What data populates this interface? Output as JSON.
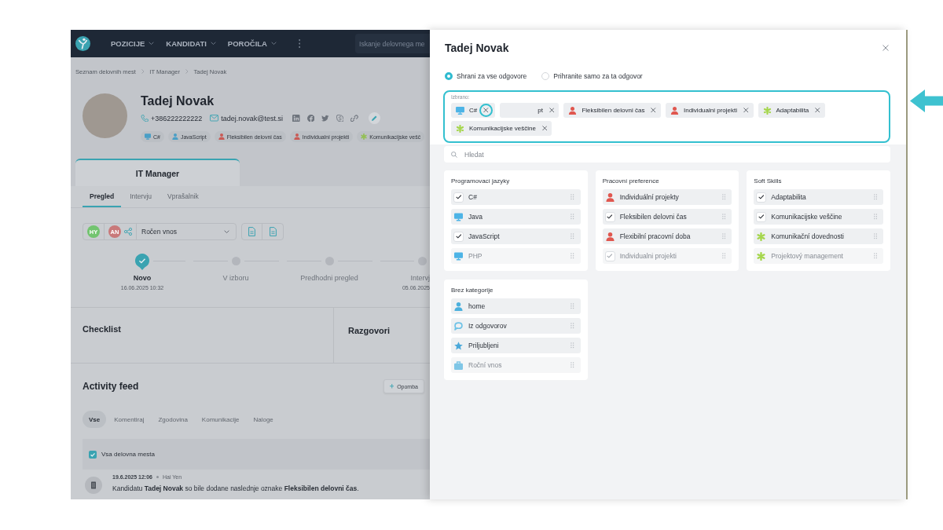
{
  "navbar": {
    "menu": [
      {
        "label": "POZICIJE"
      },
      {
        "label": "KANDIDATI"
      },
      {
        "label": "POROČILA"
      }
    ],
    "search": {
      "placeholder": "Iskanje delovnega me"
    }
  },
  "breadcrumb": [
    {
      "label": "Seznam delovnih mest"
    },
    {
      "label": "IT Manager"
    },
    {
      "label": "Tadej Novak"
    }
  ],
  "candidate": {
    "name": "Tadej Novak",
    "phone": "+386222222222",
    "email": "tadej.novak@test.si",
    "tags": [
      {
        "label": "C#",
        "kind": "monitor",
        "color": "#4a9fc6"
      },
      {
        "label": "JavaScript",
        "kind": "person",
        "color": "#4a9fc6"
      },
      {
        "label": "Fleksibilen delovni čas",
        "kind": "person",
        "color": "#c95a55"
      },
      {
        "label": "Individualni projekti",
        "kind": "person",
        "color": "#c95a55"
      },
      {
        "label": "Komunikacijske vešč",
        "kind": "asterisk",
        "color": "#93bf55"
      }
    ]
  },
  "position_tab": {
    "title": "IT Manager"
  },
  "subtabs": [
    {
      "label": "Pregled",
      "selected": true
    },
    {
      "label": "Intervju",
      "selected": false
    },
    {
      "label": "Vprašalnik",
      "selected": false
    }
  ],
  "toolbar": {
    "avatars": [
      {
        "initials": "HY",
        "color": "#72c46f"
      },
      {
        "initials": "AN",
        "color": "#c9797a"
      }
    ],
    "source": "Ročen vnos"
  },
  "pipeline": [
    {
      "label": "Novo",
      "date": "16.06.2025 10:32",
      "done": true
    },
    {
      "label": "V izboru",
      "done": false
    },
    {
      "label": "Predhodni pregled",
      "done": false
    },
    {
      "label": "Intervj",
      "date": "05.06.2025",
      "done": false
    }
  ],
  "sections": [
    {
      "title": "Checklist"
    },
    {
      "title": "Razgovori"
    }
  ],
  "activity": {
    "title": "Activity feed",
    "add_button": "Opomba",
    "filters": [
      {
        "label": "Vse",
        "selected": true
      },
      {
        "label": "Komentiraj",
        "selected": false
      },
      {
        "label": "Zgodovina",
        "selected": false
      },
      {
        "label": "Komunikacije",
        "selected": false
      },
      {
        "label": "Naloge",
        "selected": false
      }
    ],
    "all_positions": {
      "label": "Vsa delovna mesta",
      "checked": true
    },
    "entries": [
      {
        "time": "19.6.2025 12:06",
        "author": "Hai Yen",
        "text": "Kandidatu **Tadej Novak** so bile dodane naslednje oznake **Fleksibilen delovni čas**."
      }
    ]
  },
  "drawer": {
    "title": "Tadej Novak",
    "scope": [
      {
        "label": "Shrani za vse odgovore",
        "selected": true
      },
      {
        "label": "Prihranite samo za ta odgovor",
        "selected": false
      }
    ],
    "selected_tags": {
      "label": "Izbrano:",
      "tags": [
        {
          "label": "C#",
          "kind": "monitor",
          "color": "#4db4e6",
          "highlighted": true
        },
        {
          "label": "pt",
          "highlighted": false
        },
        {
          "label": "Fleksibilen delovni čas",
          "kind": "person",
          "color": "#e0574f",
          "highlighted": false
        },
        {
          "label": "Individualni projekti",
          "kind": "person",
          "color": "#e0574f",
          "highlighted": false
        },
        {
          "label": "Adaptabilita",
          "kind": "asterisk",
          "color": "#a5d64c",
          "highlighted": false
        },
        {
          "label": "Komunikacijske veščine",
          "kind": "asterisk",
          "color": "#a5d64c",
          "highlighted": false
        }
      ]
    },
    "search": {
      "placeholder": "Hledat"
    },
    "categories": [
      {
        "title": "Programovací jazyky",
        "items": [
          {
            "label": "C#",
            "checked": true
          },
          {
            "label": "Java",
            "checked": false,
            "kind": "monitor",
            "color": "#4db4e6"
          },
          {
            "label": "JavaScript",
            "checked": true
          },
          {
            "label": "PHP",
            "checked": false,
            "kind": "monitor",
            "color": "#4db4e6"
          }
        ]
      },
      {
        "title": "Pracovní preference",
        "items": [
          {
            "label": "Individuální projekty",
            "checked": false,
            "kind": "person",
            "color": "#e0574f"
          },
          {
            "label": "Fleksibilen delovni čas",
            "checked": true
          },
          {
            "label": "Flexibilní pracovní doba",
            "checked": false,
            "kind": "person",
            "color": "#e0574f"
          },
          {
            "label": "Individualni projekti",
            "checked": true
          }
        ]
      },
      {
        "title": "Soft Skills",
        "items": [
          {
            "label": "Adaptabilita",
            "checked": true
          },
          {
            "label": "Komunikacijske veščine",
            "checked": true
          },
          {
            "label": "Komunikační dovednosti",
            "checked": false,
            "kind": "asterisk",
            "color": "#a5d64c"
          },
          {
            "label": "Projektový management",
            "checked": false,
            "kind": "asterisk",
            "color": "#a5d64c"
          }
        ]
      },
      {
        "title": "Brez kategorije",
        "items": [
          {
            "label": "home",
            "checked": false,
            "kind": "person",
            "color": "#4bb0dd"
          },
          {
            "label": "Iz odgovorov",
            "checked": false,
            "kind": "chat",
            "color": "#6ec2e6"
          },
          {
            "label": "Priljubljeni",
            "checked": false,
            "kind": "star",
            "color": "#4ba9da"
          },
          {
            "label": "Roční vnos",
            "checked": false,
            "kind": "briefcase",
            "color": "#7fc6e6"
          }
        ]
      }
    ]
  }
}
